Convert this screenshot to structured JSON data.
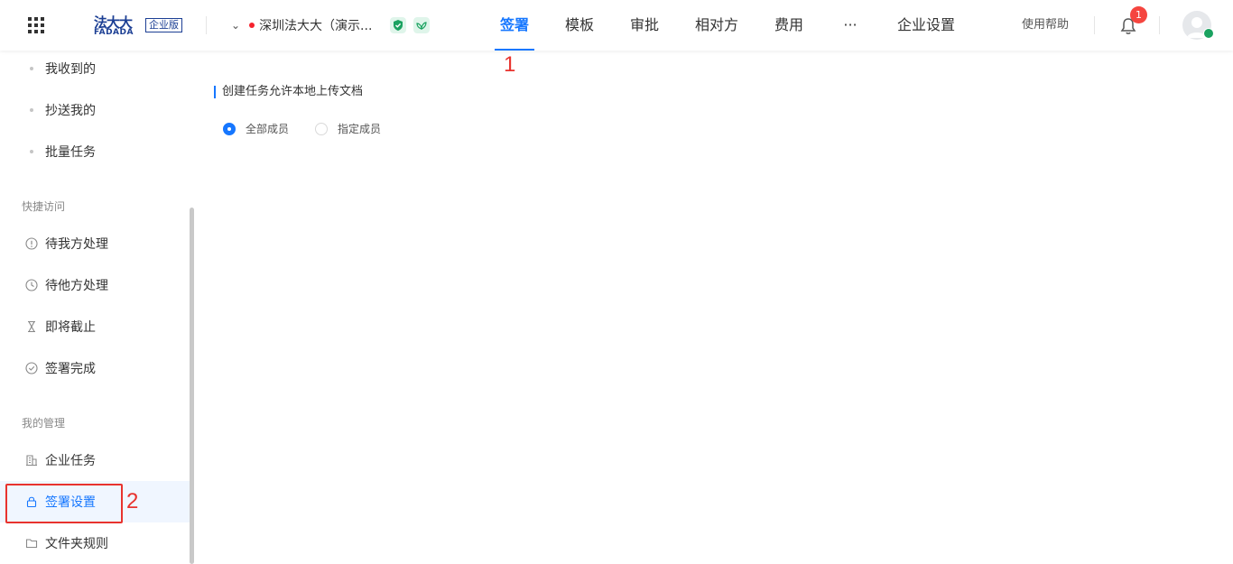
{
  "header": {
    "logo_cn": "法大大",
    "logo_en": "FADADA",
    "edition": "企业版",
    "company_name": "深圳法大大（演示...",
    "nav": [
      {
        "label": "签署",
        "active": true
      },
      {
        "label": "模板"
      },
      {
        "label": "审批"
      },
      {
        "label": "相对方"
      },
      {
        "label": "费用"
      },
      {
        "label": "···"
      },
      {
        "label": "企业设置"
      }
    ],
    "help": "使用帮助",
    "notification_count": "1"
  },
  "sidebar": {
    "top_items": [
      {
        "label": "我收到的"
      },
      {
        "label": "抄送我的"
      },
      {
        "label": "批量任务"
      }
    ],
    "quick_access_title": "快捷访问",
    "quick_items": [
      {
        "label": "待我方处理",
        "icon": "alert-circle-icon"
      },
      {
        "label": "待他方处理",
        "icon": "clock-icon"
      },
      {
        "label": "即将截止",
        "icon": "hourglass-icon"
      },
      {
        "label": "签署完成",
        "icon": "check-circle-icon"
      }
    ],
    "manage_title": "我的管理",
    "manage_items": [
      {
        "label": "企业任务",
        "icon": "building-icon"
      },
      {
        "label": "签署设置",
        "icon": "lock-icon",
        "selected": true
      },
      {
        "label": "文件夹规则",
        "icon": "folder-icon"
      }
    ]
  },
  "main": {
    "section_title": "创建任务允许本地上传文档",
    "options": [
      {
        "label": "全部成员",
        "checked": true
      },
      {
        "label": "指定成员",
        "checked": false
      }
    ]
  },
  "annotations": [
    "1",
    "2"
  ],
  "colors": {
    "accent": "#1677ff",
    "annotation": "#e8332e",
    "brand": "#1c3f94"
  }
}
